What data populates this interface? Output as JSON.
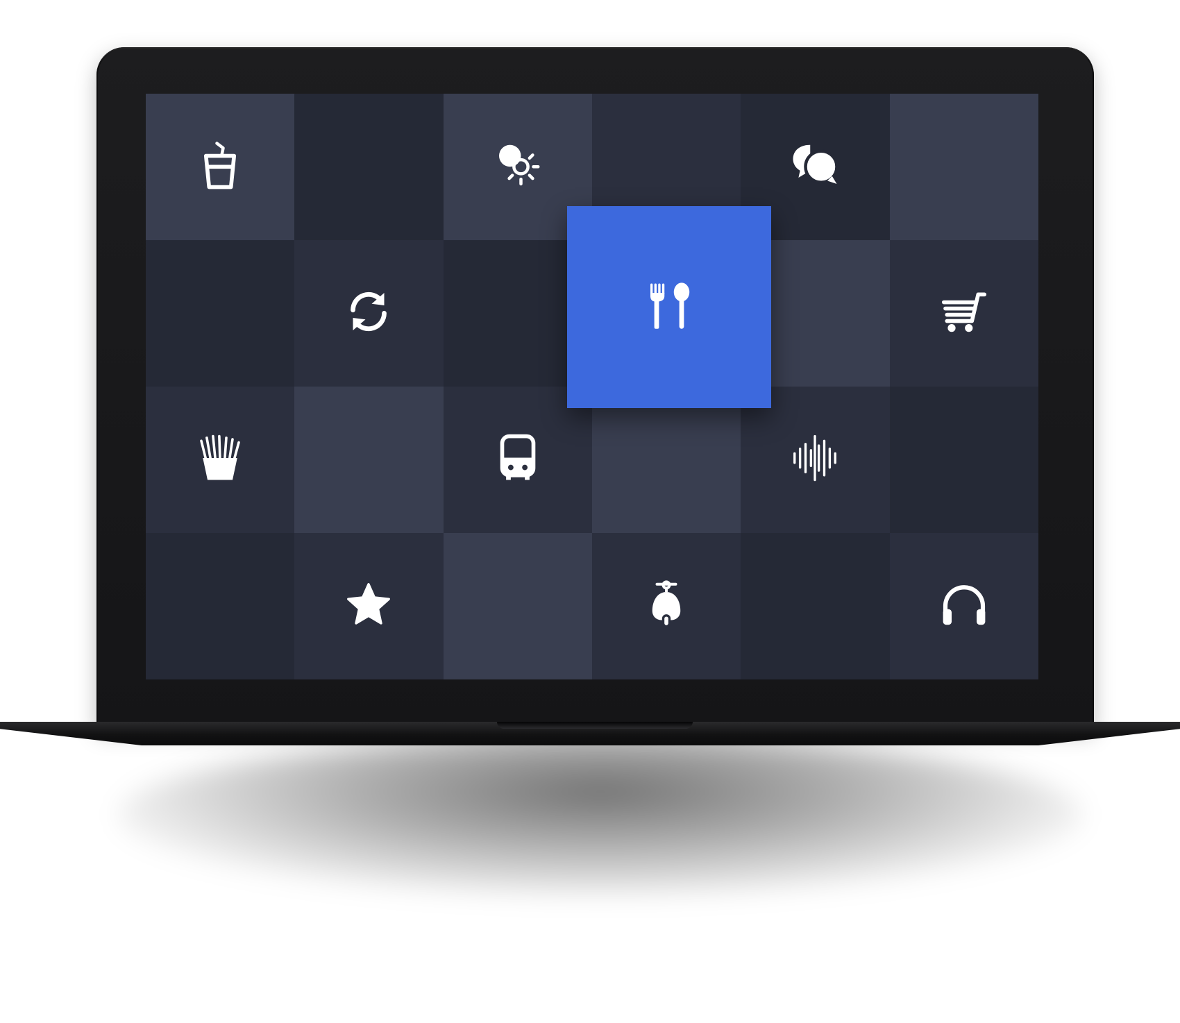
{
  "device": "laptop",
  "colors": {
    "tile_dark": "#252936",
    "tile_mid": "#2b2f3e",
    "tile_light": "#393e50",
    "accent": "#3d69dd",
    "icon": "#ffffff"
  },
  "grid": {
    "columns": 6,
    "rows": 4,
    "tiles": [
      {
        "shade": "light",
        "icon": "drink-cup-icon"
      },
      {
        "shade": "dark",
        "icon": ""
      },
      {
        "shade": "light",
        "icon": "day-night-icon"
      },
      {
        "shade": "mid",
        "icon": ""
      },
      {
        "shade": "dark",
        "icon": "chat-bubbles-icon"
      },
      {
        "shade": "light",
        "icon": ""
      },
      {
        "shade": "dark",
        "icon": ""
      },
      {
        "shade": "mid",
        "icon": "refresh-icon"
      },
      {
        "shade": "dark",
        "icon": ""
      },
      {
        "shade": "mid",
        "icon": ""
      },
      {
        "shade": "light",
        "icon": ""
      },
      {
        "shade": "mid",
        "icon": "shopping-cart-icon"
      },
      {
        "shade": "mid",
        "icon": "french-fries-icon"
      },
      {
        "shade": "light",
        "icon": ""
      },
      {
        "shade": "mid",
        "icon": "bus-icon"
      },
      {
        "shade": "light",
        "icon": ""
      },
      {
        "shade": "mid",
        "icon": "sound-wave-icon"
      },
      {
        "shade": "dark",
        "icon": ""
      },
      {
        "shade": "dark",
        "icon": ""
      },
      {
        "shade": "mid",
        "icon": "star-icon"
      },
      {
        "shade": "light",
        "icon": ""
      },
      {
        "shade": "mid",
        "icon": "scooter-icon"
      },
      {
        "shade": "dark",
        "icon": ""
      },
      {
        "shade": "mid",
        "icon": "headphones-icon"
      }
    ],
    "focused": {
      "icon": "fork-spoon-icon",
      "state": "selected"
    }
  }
}
